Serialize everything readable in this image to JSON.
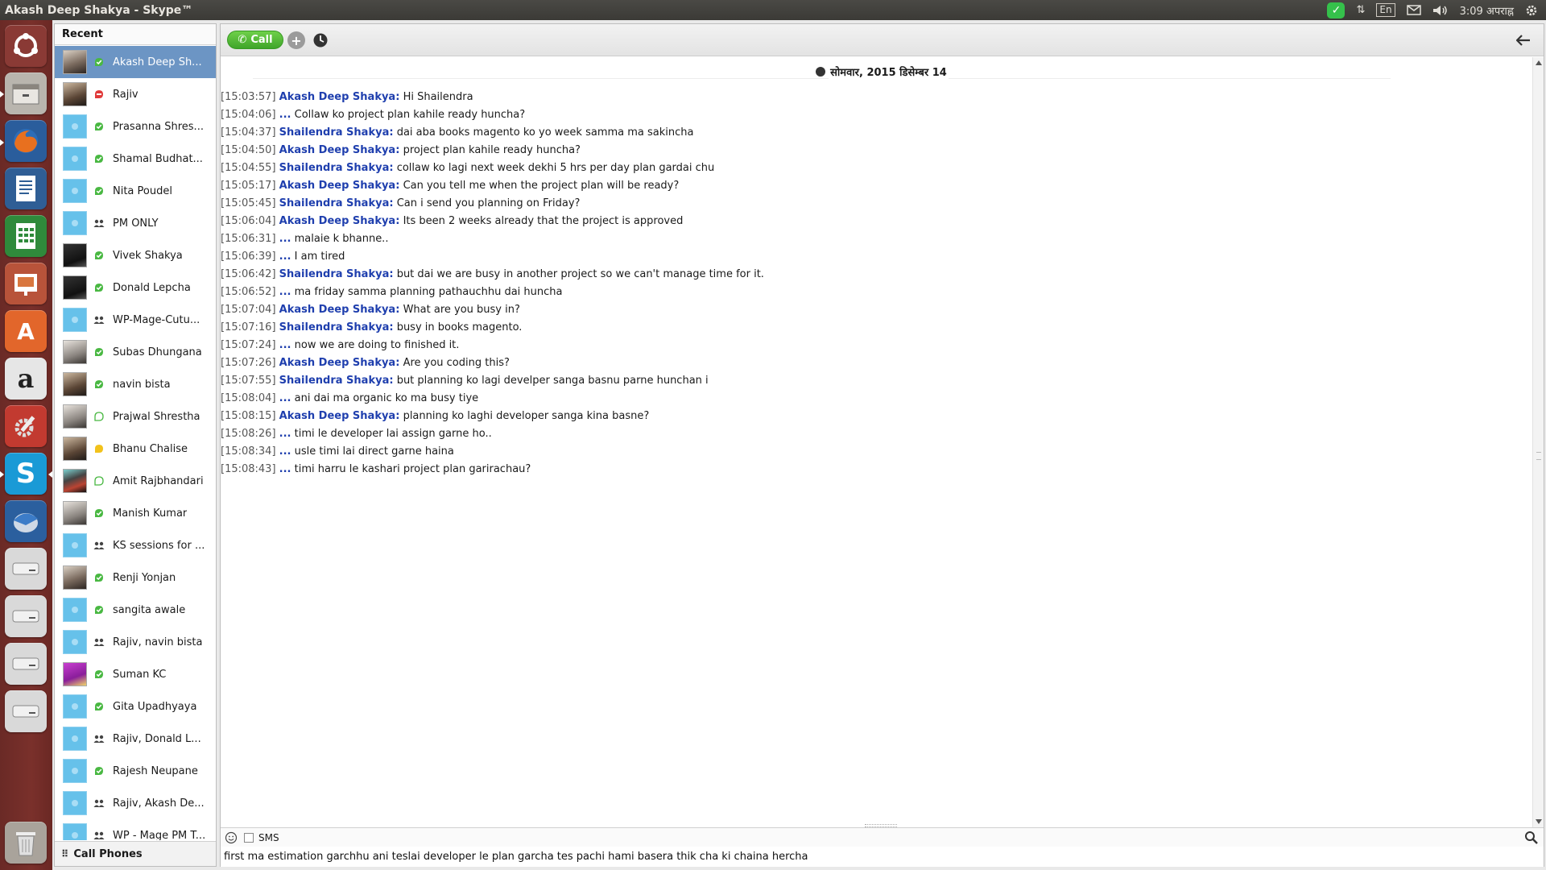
{
  "window": {
    "title": "Akash Deep Shakya - Skype™"
  },
  "indicators": {
    "lang": "En",
    "time": "3:09 अपराह्न"
  },
  "contacts": {
    "header": "Recent",
    "items": [
      {
        "name": "Akash Deep Sh...",
        "status": "online",
        "avatar": "photo",
        "selected": true
      },
      {
        "name": "Rajiv",
        "status": "busy",
        "avatar": "p2"
      },
      {
        "name": "Prasanna Shres...",
        "status": "online",
        "avatar": "def"
      },
      {
        "name": "Shamal Budhat...",
        "status": "online",
        "avatar": "def"
      },
      {
        "name": "Nita Poudel",
        "status": "online",
        "avatar": "def"
      },
      {
        "name": "PM ONLY",
        "status": "group",
        "avatar": "def"
      },
      {
        "name": "Vivek Shakya",
        "status": "online",
        "avatar": "p3"
      },
      {
        "name": "Donald Lepcha",
        "status": "online",
        "avatar": "p3"
      },
      {
        "name": "WP-Mage-Cutu...",
        "status": "group",
        "avatar": "def"
      },
      {
        "name": "Subas Dhungana",
        "status": "online",
        "avatar": "p4"
      },
      {
        "name": "navin bista",
        "status": "online",
        "avatar": "p2"
      },
      {
        "name": "Prajwal Shrestha",
        "status": "offline",
        "avatar": "p4"
      },
      {
        "name": "Bhanu Chalise",
        "status": "away",
        "avatar": "p2"
      },
      {
        "name": "Amit Rajbhandari",
        "status": "offline",
        "avatar": "p6"
      },
      {
        "name": "Manish  Kumar",
        "status": "online",
        "avatar": "p4"
      },
      {
        "name": "KS sessions for ...",
        "status": "group",
        "avatar": "def"
      },
      {
        "name": "Renji Yonjan",
        "status": "online",
        "avatar": "photo"
      },
      {
        "name": "sangita awale",
        "status": "online",
        "avatar": "def"
      },
      {
        "name": "Rajiv, navin bista",
        "status": "group",
        "avatar": "def"
      },
      {
        "name": "Suman KC",
        "status": "online",
        "avatar": "p5"
      },
      {
        "name": "Gita Upadhyaya",
        "status": "online",
        "avatar": "def"
      },
      {
        "name": "Rajiv, Donald L...",
        "status": "group",
        "avatar": "def"
      },
      {
        "name": "Rajesh Neupane",
        "status": "online",
        "avatar": "def"
      },
      {
        "name": "Rajiv, Akash De...",
        "status": "group",
        "avatar": "def"
      },
      {
        "name": "WP - Mage PM T...",
        "status": "group",
        "avatar": "def"
      }
    ],
    "footer": "Call Phones"
  },
  "toolbar": {
    "call_label": "Call",
    "add_label": "+"
  },
  "chat": {
    "date": "सोमवार, 2015 डिसेम्बर 14",
    "messages": [
      {
        "ts": "[15:03:57]",
        "sender": "Akash Deep Shakya:",
        "text": "Hi Shailendra"
      },
      {
        "ts": "[15:04:06]",
        "sender": "...",
        "text": "Collaw ko project plan kahile ready huncha?"
      },
      {
        "ts": "[15:04:37]",
        "sender": "Shailendra Shakya:",
        "text": "dai aba books magento ko yo week samma ma sakincha"
      },
      {
        "ts": "[15:04:50]",
        "sender": "Akash Deep Shakya:",
        "text": "project plan kahile ready huncha?"
      },
      {
        "ts": "[15:04:55]",
        "sender": "Shailendra Shakya:",
        "text": "collaw ko lagi next week dekhi 5 hrs per day plan gardai chu"
      },
      {
        "ts": "[15:05:17]",
        "sender": "Akash Deep Shakya:",
        "text": "Can you tell me when the project plan will be ready?"
      },
      {
        "ts": "[15:05:45]",
        "sender": "Shailendra Shakya:",
        "text": "Can i send you planning on Friday?"
      },
      {
        "ts": "[15:06:04]",
        "sender": "Akash Deep Shakya:",
        "text": "Its been 2 weeks already that the project is approved"
      },
      {
        "ts": "[15:06:31]",
        "sender": "...",
        "text": "malaie k bhanne.."
      },
      {
        "ts": "[15:06:39]",
        "sender": "...",
        "text": "I am tired"
      },
      {
        "ts": "[15:06:42]",
        "sender": "Shailendra Shakya:",
        "text": "but dai we are busy in another project so we can't manage time for it."
      },
      {
        "ts": "[15:06:52]",
        "sender": "...",
        "text": "ma friday samma planning pathauchhu dai huncha"
      },
      {
        "ts": "[15:07:04]",
        "sender": "Akash Deep Shakya:",
        "text": "What are you busy in?"
      },
      {
        "ts": "[15:07:16]",
        "sender": "Shailendra Shakya:",
        "text": "busy in books magento."
      },
      {
        "ts": "[15:07:24]",
        "sender": "...",
        "text": "now we are doing to finished it."
      },
      {
        "ts": "[15:07:26]",
        "sender": "Akash Deep Shakya:",
        "text": "Are you coding this?"
      },
      {
        "ts": "[15:07:55]",
        "sender": "Shailendra Shakya:",
        "text": "but planning ko lagi develper sanga basnu parne hunchan i"
      },
      {
        "ts": "[15:08:04]",
        "sender": "...",
        "text": "ani dai ma organic ko ma busy tiye"
      },
      {
        "ts": "[15:08:15]",
        "sender": "Akash Deep Shakya:",
        "text": "planning ko laghi developer sanga kina basne?"
      },
      {
        "ts": "[15:08:26]",
        "sender": "...",
        "text": "timi le developer lai assign garne ho.."
      },
      {
        "ts": "[15:08:34]",
        "sender": "...",
        "text": "usle timi lai direct garne haina"
      },
      {
        "ts": "[15:08:43]",
        "sender": "...",
        "text": "timi harru le kashari project plan garirachau?"
      }
    ]
  },
  "compose": {
    "sms_label": "SMS",
    "value": "first ma estimation garchhu ani teslai developer le plan garcha tes pachi hami basera thik cha ki chaina hercha"
  },
  "colors": {
    "accent": "#6c95c4",
    "call": "#4cb531",
    "sender": "#1f3fae",
    "launcher": "#742d28"
  }
}
